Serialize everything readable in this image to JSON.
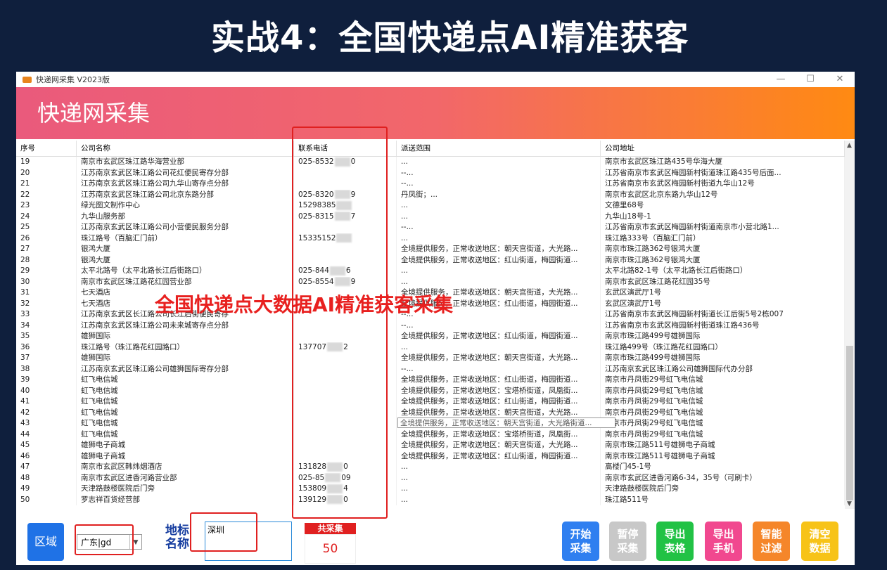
{
  "slide_title": "实战4：全国快递点AI精准获客",
  "window": {
    "title": "快递网采集 V2023版",
    "minimize": "—",
    "maximize": "☐",
    "close": "✕"
  },
  "banner_title": "快递网采集",
  "table": {
    "headers": [
      "序号",
      "公司名称",
      "联系电话",
      "派送范围",
      "公司地址"
    ],
    "rows": [
      {
        "no": "19",
        "name": "南京市玄武区珠江路华海营业部",
        "phone_pre": "025-8532",
        "phone_suf": "0",
        "scope": "...",
        "address": "南京市玄武区珠江路435号华海大厦"
      },
      {
        "no": "20",
        "name": "江苏南京玄武区珠江路公司花红便民寄存分部",
        "phone_pre": "",
        "phone_suf": "",
        "scope": "--...",
        "address": "江苏省南京市玄武区梅园新村街道珠江路435号后面..."
      },
      {
        "no": "21",
        "name": "江苏南京玄武区珠江路公司九华山寄存点分部",
        "phone_pre": "",
        "phone_suf": "",
        "scope": "--...",
        "address": "江苏省南京市玄武区梅园新村街道九华山12号"
      },
      {
        "no": "22",
        "name": "江苏南京玄武区珠江路公司北京东路分部",
        "phone_pre": "025-8320",
        "phone_suf": "9",
        "scope": "丹凤街；...",
        "address": "南京市玄武区北京东路九华山12号"
      },
      {
        "no": "23",
        "name": "绿光图文制作中心",
        "phone_pre": "15298385",
        "phone_suf": "",
        "scope": "...",
        "address": "文德里68号"
      },
      {
        "no": "24",
        "name": "九华山服务部",
        "phone_pre": "025-8315",
        "phone_suf": "7",
        "scope": "...",
        "address": "九华山18号-1"
      },
      {
        "no": "25",
        "name": "江苏南京玄武区珠江路公司小营便民服务分部",
        "phone_pre": "",
        "phone_suf": "",
        "scope": "--...",
        "address": "江苏省南京市玄武区梅园新村街道南京市小营北路1..."
      },
      {
        "no": "26",
        "name": "珠江路号（百脑汇门前）",
        "phone_pre": "15335152",
        "phone_suf": "",
        "scope": "...",
        "address": "珠江路333号（百脑汇门前）"
      },
      {
        "no": "27",
        "name": "银鸿大厦",
        "phone_pre": "",
        "phone_suf": "",
        "scope": "全境提供服务，正常收送地区：朝天宫街道，大光路...",
        "address": "南京市珠江路362号银鸿大厦"
      },
      {
        "no": "28",
        "name": "银鸿大厦",
        "phone_pre": "",
        "phone_suf": "",
        "scope": "全境提供服务，正常收送地区：红山街道，梅园街道...",
        "address": "南京市珠江路362号银鸿大厦"
      },
      {
        "no": "29",
        "name": "太平北路号（太平北路长江后街路口）",
        "phone_pre": "025-844",
        "phone_suf": "6",
        "scope": "...",
        "address": "太平北路82-1号（太平北路长江后街路口）"
      },
      {
        "no": "30",
        "name": "南京市玄武区珠江路花红园营业部",
        "phone_pre": "025-8554",
        "phone_suf": "9",
        "scope": "...",
        "address": "南京市玄武区珠江路花红园35号"
      },
      {
        "no": "31",
        "name": "七天酒店",
        "phone_pre": "",
        "phone_suf": "",
        "scope": "全境提供服务，正常收送地区：朝天宫街道，大光路...",
        "address": "玄武区演武厅1号"
      },
      {
        "no": "32",
        "name": "七天酒店",
        "phone_pre": "",
        "phone_suf": "",
        "scope": "全境提供服务，正常收送地区：红山街道，梅园街道...",
        "address": "玄武区演武厅1号"
      },
      {
        "no": "33",
        "name": "江苏南京玄武区长江路公司长江后街便民寄存",
        "phone_pre": "",
        "phone_suf": "",
        "scope": "--...",
        "address": "江苏省南京市玄武区梅园新村街道长江后街5号2栋007"
      },
      {
        "no": "34",
        "name": "江苏南京玄武区珠江路公司未来城寄存点分部",
        "phone_pre": "",
        "phone_suf": "",
        "scope": "--...",
        "address": "江苏省南京市玄武区梅园新村街道珠江路436号"
      },
      {
        "no": "35",
        "name": "雄狮国际",
        "phone_pre": "",
        "phone_suf": "",
        "scope": "全境提供服务，正常收送地区：红山街道，梅园街道...",
        "address": "南京市珠江路499号雄狮国际"
      },
      {
        "no": "36",
        "name": "珠江路号（珠江路花红园路口）",
        "phone_pre": "137707",
        "phone_suf": "2",
        "scope": "...",
        "address": "珠江路499号（珠江路花红园路口）"
      },
      {
        "no": "37",
        "name": "雄狮国际",
        "phone_pre": "",
        "phone_suf": "",
        "scope": "全境提供服务，正常收送地区：朝天宫街道，大光路...",
        "address": "南京市珠江路499号雄狮国际"
      },
      {
        "no": "38",
        "name": "江苏南京玄武区珠江路公司雄狮国际寄存分部",
        "phone_pre": "",
        "phone_suf": "",
        "scope": "--...",
        "address": "江苏南京玄武区珠江路公司雄狮国际代办分部"
      },
      {
        "no": "39",
        "name": "虹飞电信城",
        "phone_pre": "",
        "phone_suf": "",
        "scope": "全境提供服务，正常收送地区：红山街道，梅园街道...",
        "address": "南京市丹凤街29号虹飞电信城"
      },
      {
        "no": "40",
        "name": "虹飞电信城",
        "phone_pre": "",
        "phone_suf": "",
        "scope": "全境提供服务，正常收送地区：宝塔桥街道，凤凰街...",
        "address": "南京市丹凤街29号虹飞电信城"
      },
      {
        "no": "41",
        "name": "虹飞电信城",
        "phone_pre": "",
        "phone_suf": "",
        "scope": "全境提供服务，正常收送地区：红山街道，梅园街道...",
        "address": "南京市丹凤街29号虹飞电信城"
      },
      {
        "no": "42",
        "name": "虹飞电信城",
        "phone_pre": "",
        "phone_suf": "",
        "scope": "全境提供服务，正常收送地区：朝天宫街道，大光路...",
        "address": "南京市丹凤街29号虹飞电信城"
      },
      {
        "no": "43",
        "name": "虹飞电信城",
        "phone_pre": "",
        "phone_suf": "",
        "scope": "",
        "address": "南京市丹凤街29号虹飞电信城"
      },
      {
        "no": "44",
        "name": "虹飞电信城",
        "phone_pre": "",
        "phone_suf": "",
        "scope": "全境提供服务，正常收送地区：宝塔桥街道，凤凰街...",
        "address": "南京市丹凤街29号虹飞电信城"
      },
      {
        "no": "45",
        "name": "雄狮电子商城",
        "phone_pre": "",
        "phone_suf": "",
        "scope": "全境提供服务，正常收送地区：朝天宫街道，大光路...",
        "address": "南京市珠江路511号雄狮电子商城"
      },
      {
        "no": "46",
        "name": "雄狮电子商城",
        "phone_pre": "",
        "phone_suf": "",
        "scope": "全境提供服务，正常收送地区：红山街道，梅园街道...",
        "address": "南京市珠江路511号雄狮电子商城"
      },
      {
        "no": "47",
        "name": "南京市玄武区韩炜烟酒店",
        "phone_pre": "131828",
        "phone_suf": "0",
        "scope": "...",
        "address": "高楼门45-1号"
      },
      {
        "no": "48",
        "name": "南京市玄武区进香河路营业部",
        "phone_pre": "025-85",
        "phone_suf": "09",
        "scope": "...",
        "address": "南京市玄武区进香河路6-34，35号（可刷卡）"
      },
      {
        "no": "49",
        "name": "天津路鼓楼医院后门旁",
        "phone_pre": "153809",
        "phone_suf": "4",
        "scope": "...",
        "address": "天津路鼓楼医院后门旁"
      },
      {
        "no": "50",
        "name": "罗志祥百货经营部",
        "phone_pre": "139129",
        "phone_suf": "0",
        "scope": "...",
        "address": "珠江路511号"
      }
    ]
  },
  "tooltip_text": "全境提供服务，正常收送地区：朝天宫街道，大光路街道...",
  "overlay_text": "全国快递点大数据AI精准获客采集",
  "bottom": {
    "region_button": "区域",
    "region_select_value": "广东|gd",
    "landmark_label": "地标名称",
    "landmark_value": "深圳",
    "count_title": "共采集",
    "count_value": "50",
    "buttons": [
      {
        "label": "开始采集",
        "color": "#2f7ff0"
      },
      {
        "label": "暂停采集",
        "color": "#c8c8c8"
      },
      {
        "label": "导出表格",
        "color": "#21c245"
      },
      {
        "label": "导出手机",
        "color": "#f1488f"
      },
      {
        "label": "智能过滤",
        "color": "#f5862a"
      },
      {
        "label": "清空数据",
        "color": "#f7c318"
      }
    ]
  }
}
